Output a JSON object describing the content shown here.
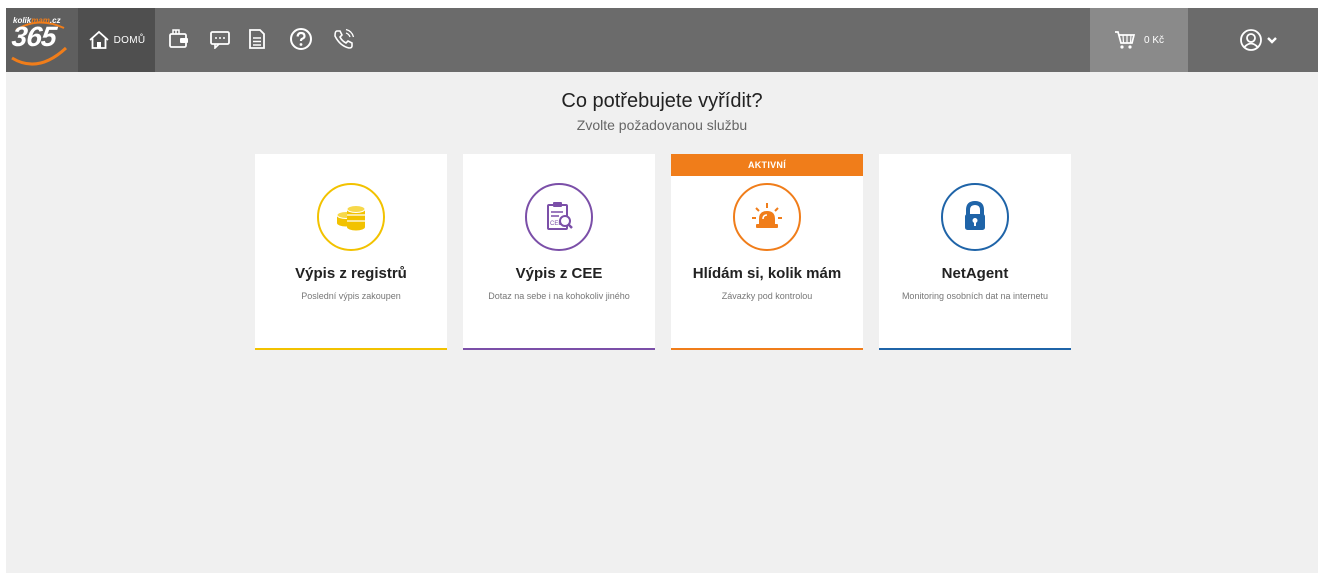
{
  "header": {
    "logo": {
      "small_text_a": "kolik",
      "small_text_b": "mam",
      "small_text_c": ".cz",
      "big_text": "365"
    },
    "home_label": "DOMŮ",
    "cart_label": "0 Kč"
  },
  "main": {
    "title": "Co potřebujete vyřídit?",
    "subtitle": "Zvolte požadovanou službu"
  },
  "cards": [
    {
      "title": "Výpis z registrů",
      "description": "Poslední výpis zakoupen",
      "color": "#f2c200",
      "icon": "coins-icon"
    },
    {
      "title": "Výpis z CEE",
      "description": "Dotaz na sebe i na kohokoliv jiného",
      "color": "#7b4fa8",
      "icon": "document-search-icon"
    },
    {
      "title": "Hlídám si, kolik mám",
      "description": "Závazky pod kontrolou",
      "color": "#f07d1a",
      "icon": "alarm-light-icon",
      "badge": "AKTIVNÍ"
    },
    {
      "title": "NetAgent",
      "description": "Monitoring osobních dat na internetu",
      "color": "#1f64a8",
      "icon": "lock-icon"
    }
  ]
}
